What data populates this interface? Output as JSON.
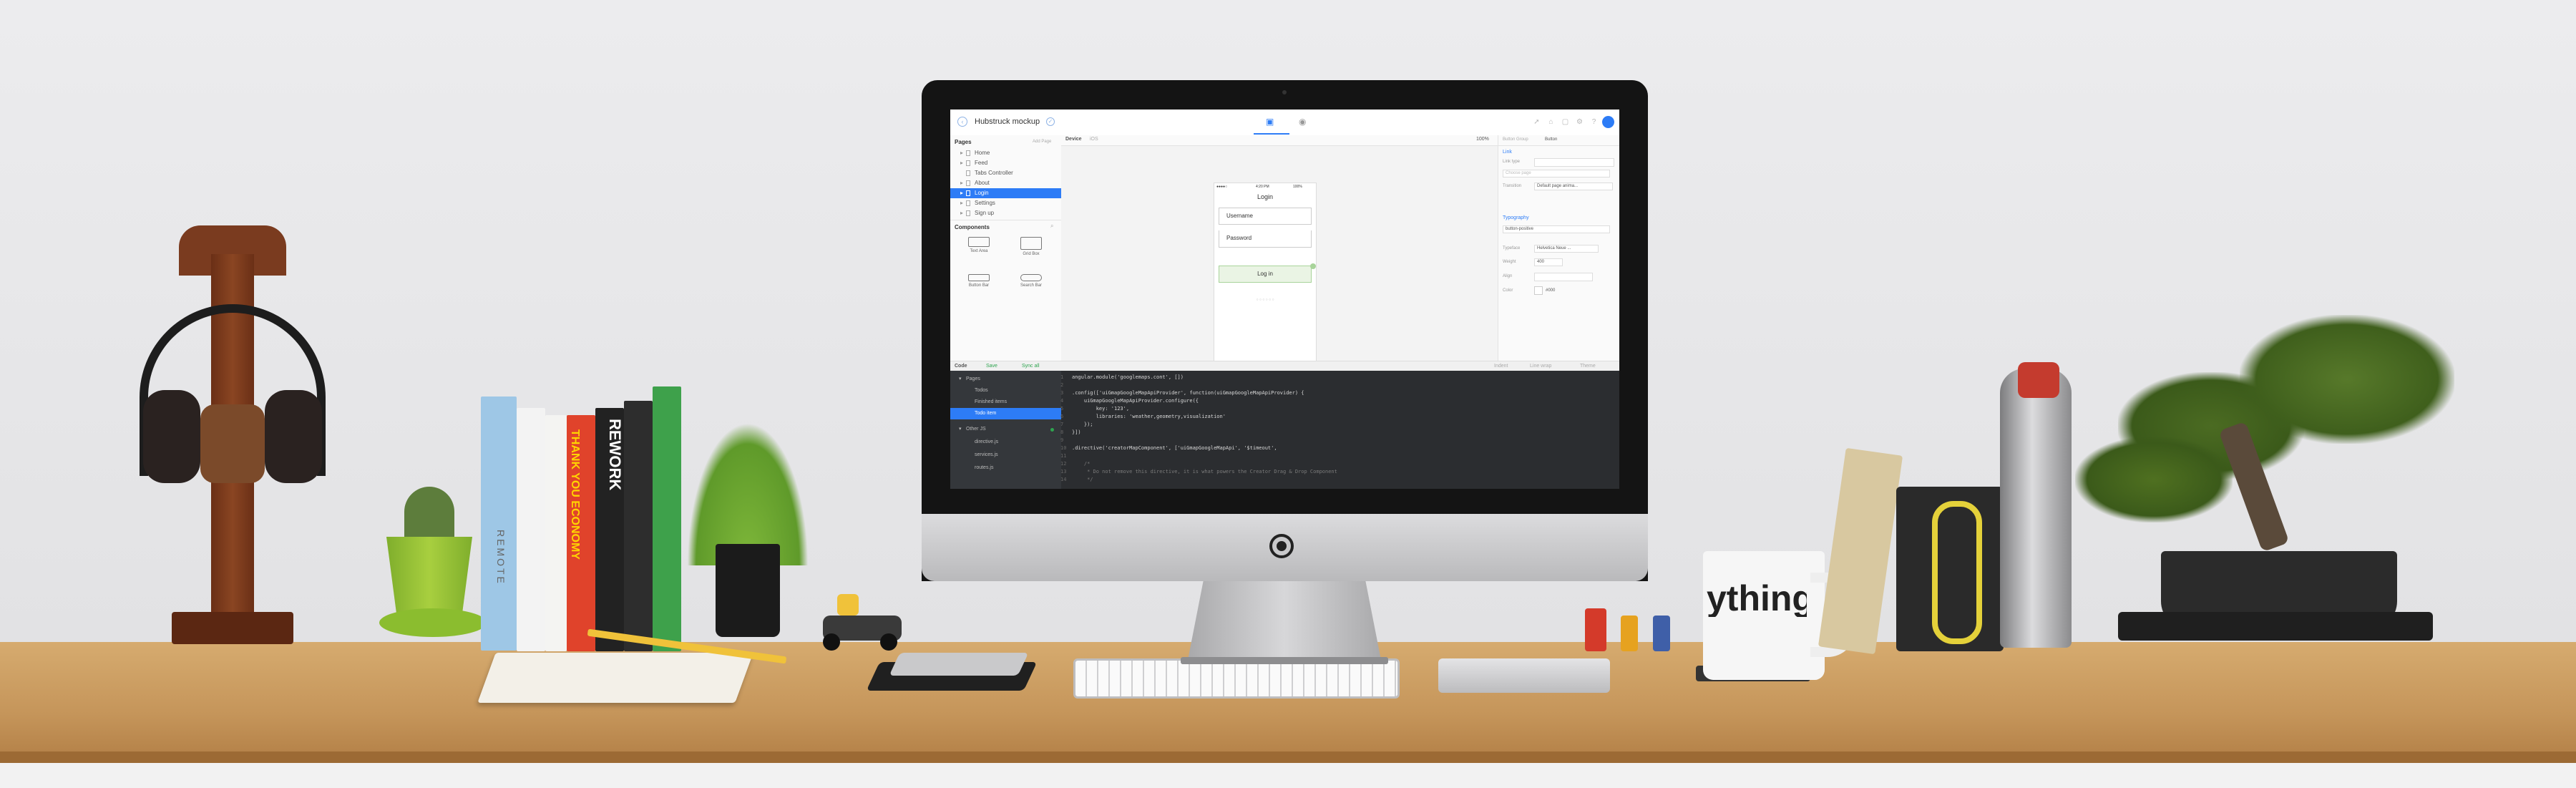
{
  "app": {
    "project_title": "Hubstruck mockup",
    "mode_tabs": [
      "design-mode-icon",
      "preview-mode-icon"
    ],
    "toolbar_icons": [
      "share-icon",
      "home-icon",
      "lock-icon",
      "settings-icon",
      "help-icon"
    ]
  },
  "left_panel": {
    "pages_heading": "Pages",
    "pages_action": "Add Page",
    "pages": [
      {
        "label": "Home",
        "selected": false
      },
      {
        "label": "Feed",
        "selected": false
      },
      {
        "label": "Tabs Controller",
        "selected": false
      },
      {
        "label": "About",
        "selected": false
      },
      {
        "label": "Login",
        "selected": true
      },
      {
        "label": "Settings",
        "selected": false
      },
      {
        "label": "Sign up",
        "selected": false
      }
    ],
    "components_heading": "Components",
    "components": [
      {
        "label": "Text Area",
        "icon": "text-area-icon"
      },
      {
        "label": "Grid Box",
        "icon": "grid-box-icon"
      },
      {
        "label": "Button Bar",
        "icon": "button-bar-icon"
      },
      {
        "label": "Search Bar",
        "icon": "search-bar-icon"
      }
    ]
  },
  "center": {
    "device_label": "Device",
    "device_value": "iOS",
    "zoom": "100%",
    "phone": {
      "carrier": "●●●●○ ",
      "time": "4:20 PM",
      "battery": "100%",
      "title": "Login",
      "username_placeholder": "Username",
      "password_placeholder": "Password",
      "login_button": "Log in",
      "dots": "○ ○ ○ ○ ○ ○"
    }
  },
  "right_panel": {
    "breadcrumb_1": "Button Group",
    "breadcrumb_2": "Button",
    "link_section": "Link",
    "link_type_label": "Link type",
    "link_placeholder": "Choose page",
    "transition_label": "Transition",
    "transition_value": "Default page anima...",
    "typography_section": "Typography",
    "typography_class": "button-positive",
    "typeface_label": "Typeface",
    "typeface_value": "Helvetica Neue ...",
    "weight_label": "Weight",
    "weight_value": "400",
    "align_label": "Align",
    "color_label": "Color",
    "color_value": "#000"
  },
  "bottom_bar": {
    "code_label": "Code",
    "save_label": "Save",
    "sync_label": "Sync all",
    "right_items": [
      "Indent",
      "Line wrap",
      "Theme"
    ]
  },
  "code_panel": {
    "tree": [
      {
        "label": "Pages",
        "selected": false
      },
      {
        "label": "Todos",
        "selected": false
      },
      {
        "label": "Finished items",
        "selected": false
      },
      {
        "label": "Todo item",
        "selected": true
      },
      {
        "label": "Other JS",
        "selected": false
      },
      {
        "label": "directive.js",
        "selected": false
      },
      {
        "label": "services.js",
        "selected": false
      },
      {
        "label": "routes.js",
        "selected": false
      }
    ],
    "lines": [
      "angular.module('googlemaps.cont', [])",
      "",
      ".config(['uiGmapGoogleMapApiProvider', function(uiGmapGoogleMapApiProvider) {",
      "    uiGmapGoogleMapApiProvider.configure({",
      "        key: '123',",
      "        libraries: 'weather,geometry,visualization'",
      "    });",
      "}])",
      "",
      ".directive('creatorMapComponent', ['uiGmapGoogleMapApi', '$timeout',",
      "",
      "    /*",
      "     * Do not remove this directive, it is what powers the Creator Drag & Drop Component",
      "     */"
    ]
  },
  "scene": {
    "mug_text": "ything is ossible.",
    "book_titles": [
      "REMOTE",
      "THANK YOU ECONOMY",
      "REWORK"
    ]
  }
}
